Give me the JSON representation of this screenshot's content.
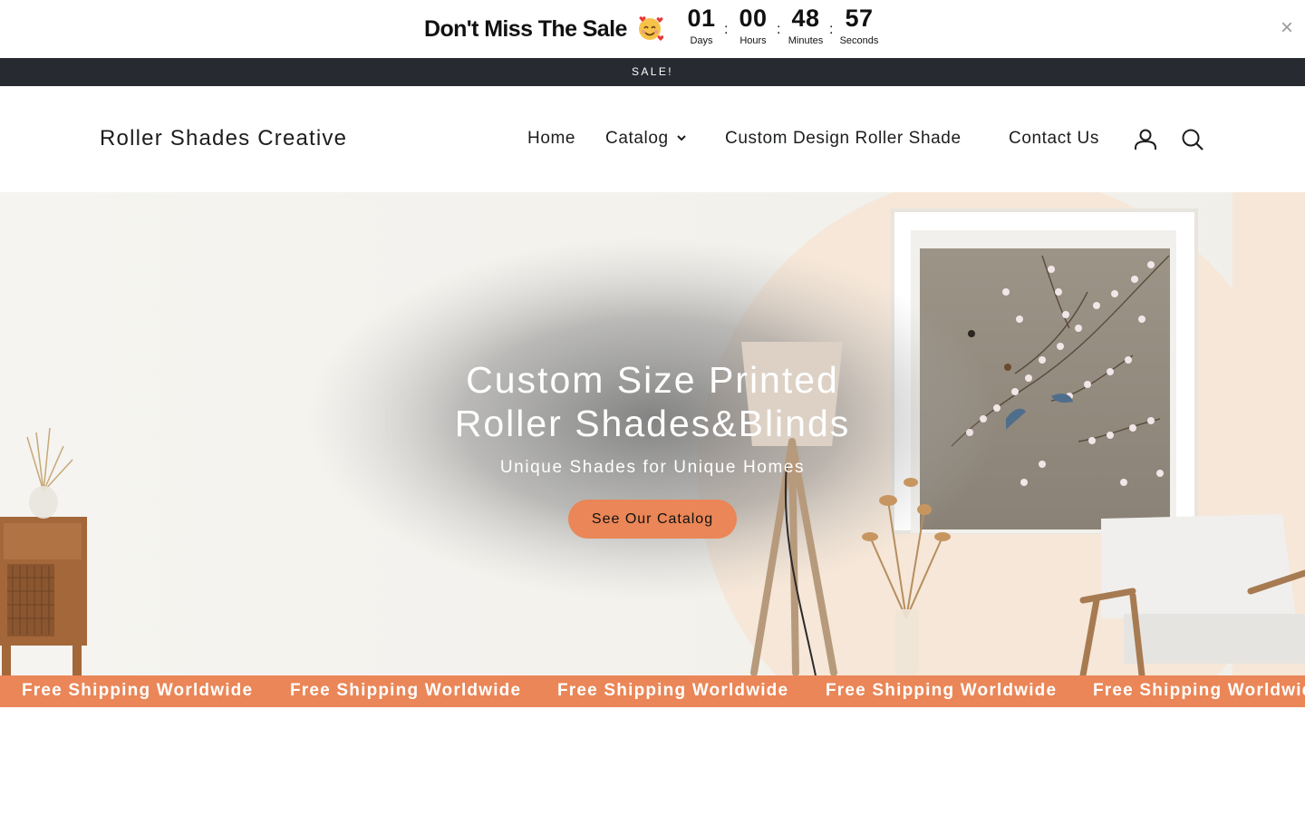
{
  "countdown": {
    "headline": "Don't Miss The Sale",
    "emoji": "smiling-face-with-hearts",
    "units": [
      {
        "value": "01",
        "label": "Days"
      },
      {
        "value": "00",
        "label": "Hours"
      },
      {
        "value": "48",
        "label": "Minutes"
      },
      {
        "value": "57",
        "label": "Seconds"
      }
    ],
    "separator": ":",
    "close_icon": "×"
  },
  "announcement": "SALE!",
  "header": {
    "brand": "Roller Shades Creative",
    "nav": [
      {
        "label": "Home"
      },
      {
        "label": "Catalog",
        "has_dropdown": true
      },
      {
        "label": "Custom Design Roller Shade"
      },
      {
        "label": "Contact Us"
      }
    ],
    "icons": [
      "account-icon",
      "search-icon"
    ]
  },
  "hero": {
    "title_line1": "Custom Size Printed",
    "title_line2": "Roller Shades&Blinds",
    "subtitle": "Unique Shades for Unique Homes",
    "button": "See Our Catalog"
  },
  "marquee": {
    "items": [
      "Free Shipping Worldwide",
      "Free Shipping Worldwide",
      "Free Shipping Worldwide",
      "Free Shipping Worldwide",
      "Free Shipping Worldwide"
    ]
  },
  "colors": {
    "accent": "#ea8657",
    "announcement_bg": "#272a30",
    "text": "#1c1d1d"
  }
}
